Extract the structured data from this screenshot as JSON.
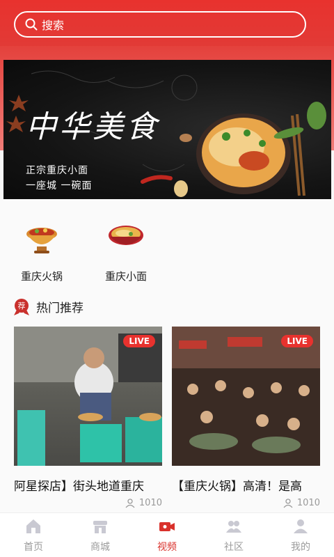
{
  "search": {
    "placeholder": "搜索"
  },
  "banner": {
    "title": "中华美食",
    "subtitle1": "正宗重庆小面",
    "subtitle2": "一座城 一碗面"
  },
  "categories": [
    {
      "label": "重庆火锅",
      "icon": "hotpot-icon"
    },
    {
      "label": "重庆小面",
      "icon": "noodle-bowl-icon"
    }
  ],
  "hot_section": {
    "badge": "荐",
    "title": "热门推荐"
  },
  "cards": [
    {
      "title": "阿星探店】街头地道重庆",
      "badge": "LIVE",
      "views": "1010"
    },
    {
      "title": "【重庆火锅】高清！是高",
      "badge": "LIVE",
      "views": "1010"
    }
  ],
  "tabs": [
    {
      "label": "首页",
      "icon": "home-icon"
    },
    {
      "label": "商城",
      "icon": "store-icon"
    },
    {
      "label": "视频",
      "icon": "video-icon"
    },
    {
      "label": "社区",
      "icon": "community-icon"
    },
    {
      "label": "我的",
      "icon": "user-icon"
    }
  ],
  "colors": {
    "accent": "#e8322e",
    "tab_active": "#d9312b",
    "tab_inactive": "#9b9b9b"
  }
}
